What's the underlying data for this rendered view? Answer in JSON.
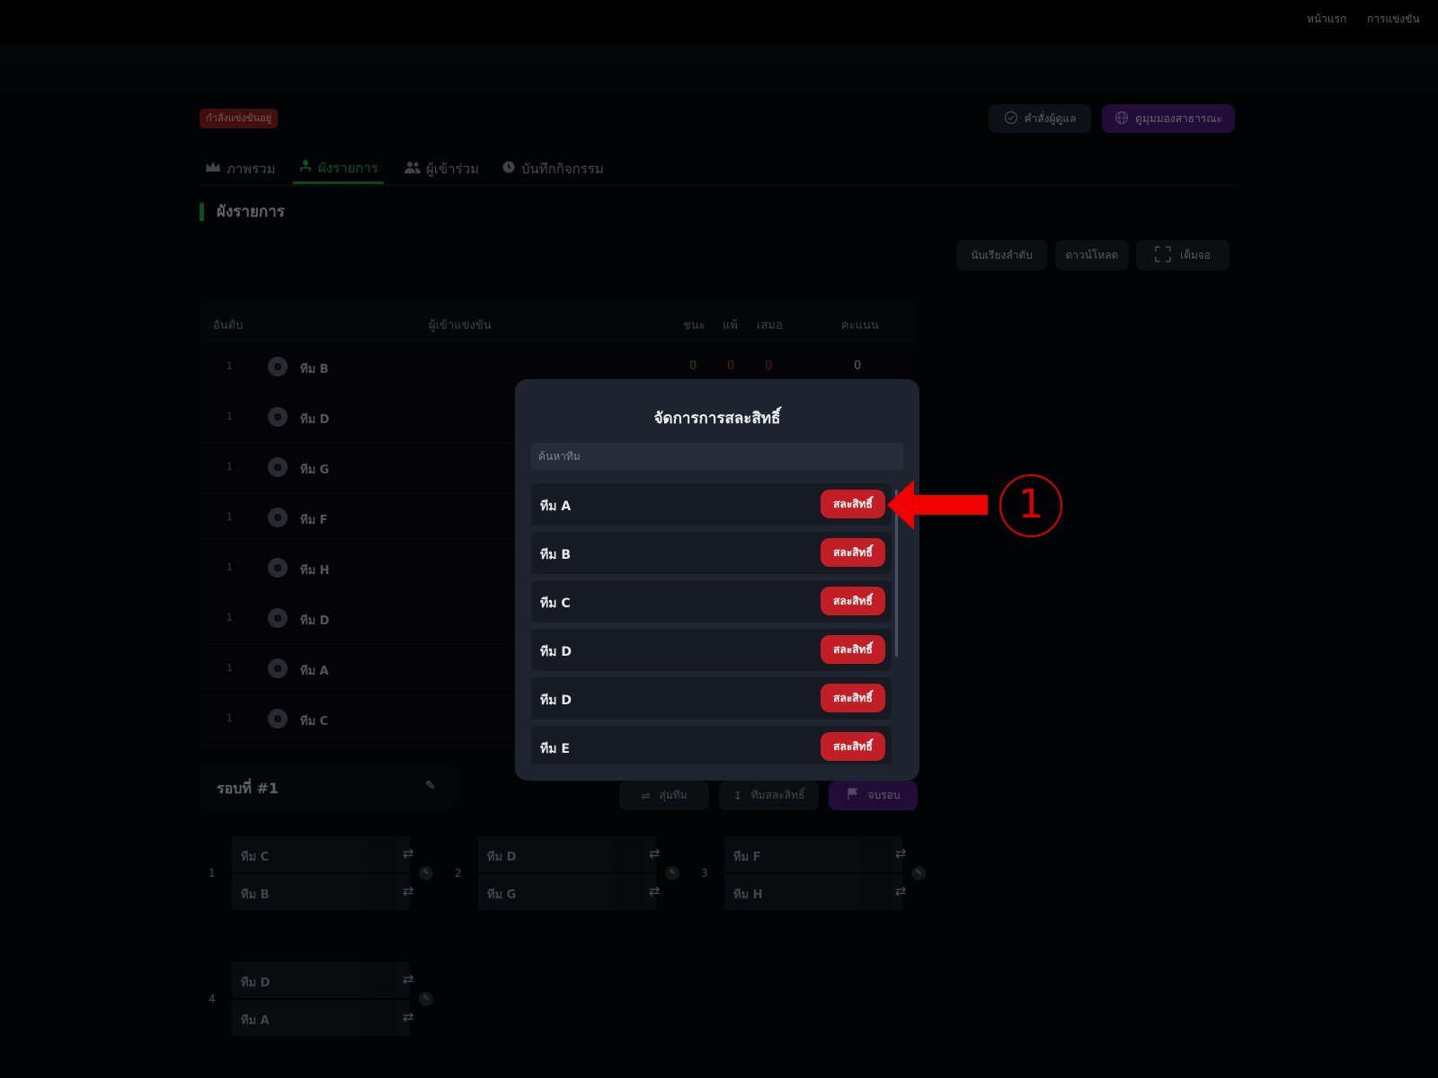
{
  "topnav": {
    "home": "หน้าแรก",
    "competitions": "การแข่งขัน"
  },
  "status_badge": "กำลังแข่งขันอยู่",
  "header_buttons": {
    "admin": "คำสั่งผู้ดูแล",
    "public_view": "ดูมุมมองสาธารณะ"
  },
  "tabs": [
    {
      "label": "ภาพรวม",
      "icon": "crown-icon"
    },
    {
      "label": "ผังรายการ",
      "icon": "bracket-icon",
      "active": true
    },
    {
      "label": "ผู้เข้าร่วม",
      "icon": "users-icon"
    },
    {
      "label": "บันทึกกิจกรรม",
      "icon": "history-icon"
    }
  ],
  "section_title": "ผังรายการ",
  "tools": {
    "sort": "นับเรียงลำดับ",
    "download": "ดาวน์โหลด",
    "fullscreen": "เต็มจอ"
  },
  "standings": {
    "headers": {
      "rank": "อันดับ",
      "participant": "ผู้เข้าแข่งขัน",
      "win": "ชนะ",
      "loss": "แพ้",
      "draw": "เสมอ",
      "score": "คะแนน"
    },
    "rows": [
      {
        "rank": "1",
        "team": "ทีม B",
        "win": "0",
        "loss": "0",
        "draw": "0",
        "score": "0"
      },
      {
        "rank": "1",
        "team": "ทีม D"
      },
      {
        "rank": "1",
        "team": "ทีม G"
      },
      {
        "rank": "1",
        "team": "ทีม F"
      },
      {
        "rank": "1",
        "team": "ทีม H"
      },
      {
        "rank": "1",
        "team": "ทีม D"
      },
      {
        "rank": "1",
        "team": "ทีม A"
      },
      {
        "rank": "1",
        "team": "ทีม C"
      }
    ]
  },
  "round": {
    "title": "รอบที่ #1"
  },
  "round_actions": {
    "shuffle": "สุ่มทีม",
    "forfeit_teams": "ทีมสละสิทธิ์",
    "end_round": "จบรอบ"
  },
  "matches": [
    {
      "num": "1",
      "team1": "ทีม C",
      "team2": "ทีม B"
    },
    {
      "num": "2",
      "team1": "ทีม D",
      "team2": "ทีม G"
    },
    {
      "num": "3",
      "team1": "ทีม F",
      "team2": "ทีม H"
    },
    {
      "num": "4",
      "team1": "ทีม D",
      "team2": "ทีม A"
    }
  ],
  "modal": {
    "title": "จัดการการสละสิทธิ์",
    "search_placeholder": "ค้นหาทีม",
    "forfeit_label": "สละสิทธิ์",
    "teams": [
      "ทีม A",
      "ทีม B",
      "ทีม C",
      "ทีม D",
      "ทีม D",
      "ทีม E"
    ]
  },
  "annotation": {
    "number": "1",
    "color": "#e10000"
  },
  "colors": {
    "accent_green": "#1fae44",
    "danger_red": "#c21e25",
    "purple": "#4b1e7a"
  }
}
